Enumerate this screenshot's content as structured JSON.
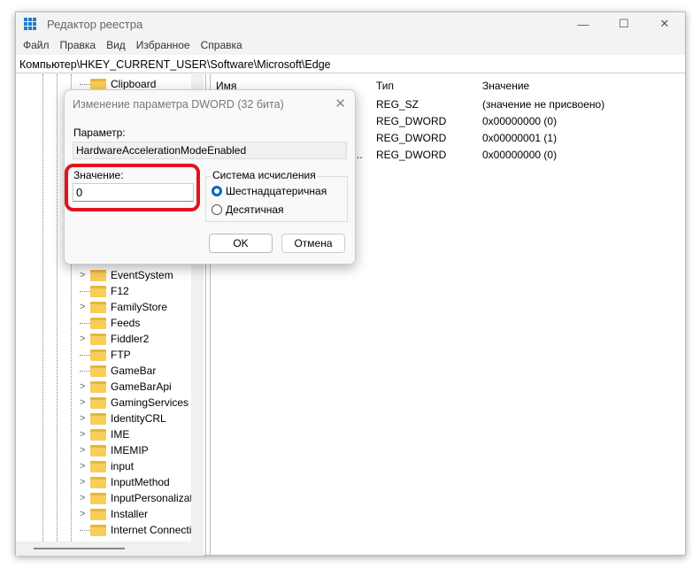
{
  "window": {
    "title": "Редактор реестра",
    "minimize": "—",
    "maximize": "☐",
    "close": "✕"
  },
  "menu": [
    "Файл",
    "Правка",
    "Вид",
    "Избранное",
    "Справка"
  ],
  "address": "Компьютер\\HKEY_CURRENT_USER\\Software\\Microsoft\\Edge",
  "tree": [
    {
      "label": "Clipboard",
      "expandable": false
    },
    {
      "label": "EventSystem",
      "expandable": true
    },
    {
      "label": "F12",
      "expandable": false
    },
    {
      "label": "FamilyStore",
      "expandable": true
    },
    {
      "label": "Feeds",
      "expandable": false
    },
    {
      "label": "Fiddler2",
      "expandable": true
    },
    {
      "label": "FTP",
      "expandable": false
    },
    {
      "label": "GameBar",
      "expandable": false
    },
    {
      "label": "GameBarApi",
      "expandable": true
    },
    {
      "label": "GamingServices",
      "expandable": true
    },
    {
      "label": "IdentityCRL",
      "expandable": true
    },
    {
      "label": "IME",
      "expandable": true
    },
    {
      "label": "IMEMIP",
      "expandable": true
    },
    {
      "label": "input",
      "expandable": true
    },
    {
      "label": "InputMethod",
      "expandable": true
    },
    {
      "label": "InputPersonalizat",
      "expandable": true
    },
    {
      "label": "Installer",
      "expandable": true
    },
    {
      "label": "Internet Connecti",
      "expandable": false
    }
  ],
  "list": {
    "headers": {
      "name": "Имя",
      "type": "Тип",
      "value": "Значение"
    },
    "rows": [
      {
        "name": "",
        "type": "REG_SZ",
        "value": "(значение не присвоено)"
      },
      {
        "name": "",
        "type": "REG_DWORD",
        "value": "0x00000000 (0)"
      },
      {
        "name": "",
        "type": "REG_DWORD",
        "value": "0x00000001 (1)"
      },
      {
        "name": "e...",
        "type": "REG_DWORD",
        "value": "0x00000000 (0)"
      }
    ]
  },
  "dialog": {
    "title": "Изменение параметра DWORD (32 бита)",
    "param_label": "Параметр:",
    "param_value": "HardwareAccelerationModeEnabled",
    "value_label": "Значение:",
    "value": "0",
    "base_label": "Система исчисления",
    "base_options": [
      "Шестнадцатеричная",
      "Десятичная"
    ],
    "base_selected": "Шестнадцатеричная",
    "ok": "OK",
    "cancel": "Отмена"
  },
  "colors": {
    "highlight": "#e0141e",
    "accent": "#0067c0"
  }
}
